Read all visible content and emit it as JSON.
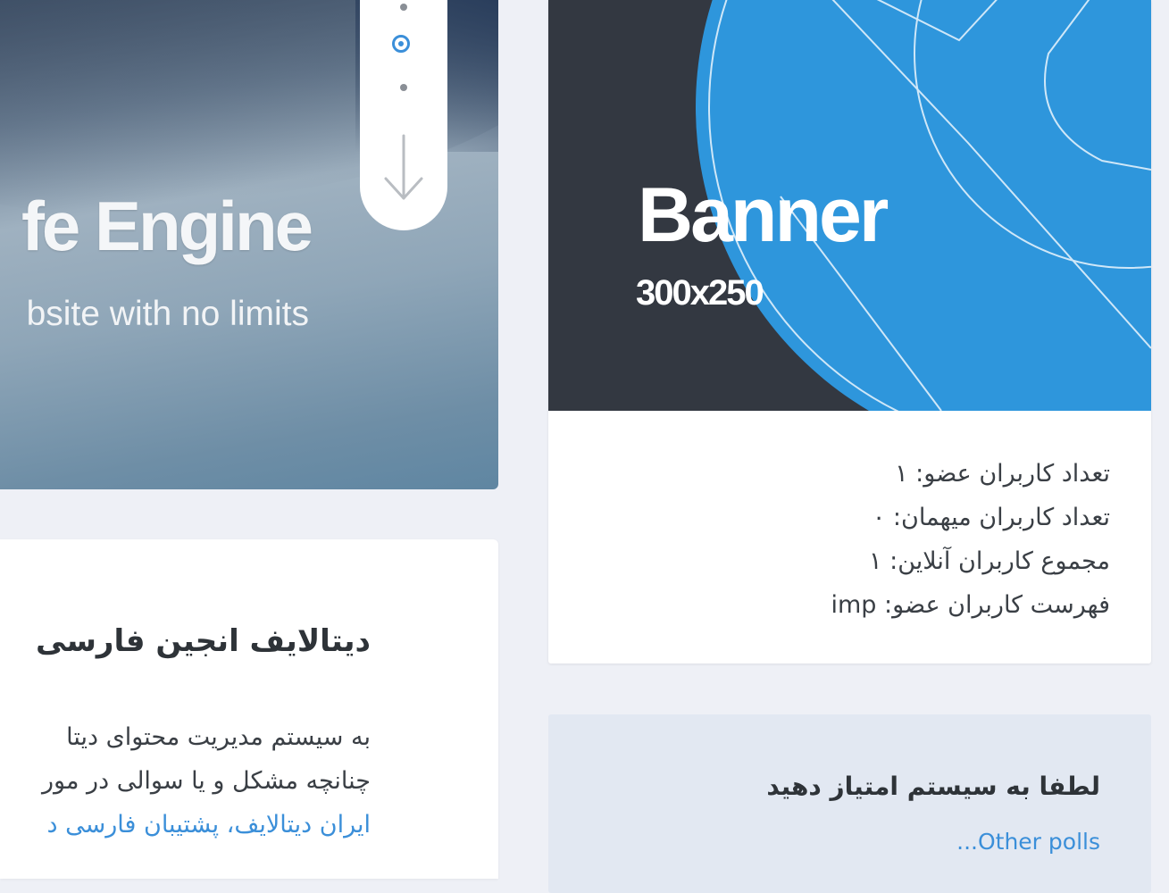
{
  "hero": {
    "title": "fe Engine",
    "subtitle": "bsite with no limits"
  },
  "scroll_nav": {
    "icons": [
      "dot-icon",
      "active-dot-icon",
      "dot-icon",
      "arrow-down-icon"
    ]
  },
  "content": {
    "title": "دیتالایف انجین فارسی",
    "lines": [
      "به سیستم مدیریت محتوای دیتا",
      "چنانچه مشکل و یا سوالی در مور",
      "ایران دیتالایف، پشتیبان فارسی د"
    ]
  },
  "banner": {
    "label": "Banner",
    "size": "300x250"
  },
  "stats": {
    "members": "تعداد کاربران عضو: ۱",
    "guests": "تعداد کاربران میهمان: ۰",
    "total_online": "مجموع کاربران آنلاین: ۱",
    "member_list": "فهرست کاربران عضو: imp"
  },
  "poll": {
    "title": "لطفا به سیستم امتیاز دهید",
    "other_polls": "...Other polls"
  },
  "colors": {
    "accent": "#3b8fd9",
    "banner_dark": "#333841",
    "banner_blue": "#2e96dc",
    "page_bg": "#eef0f6",
    "poll_bg": "#e2e8f2"
  }
}
